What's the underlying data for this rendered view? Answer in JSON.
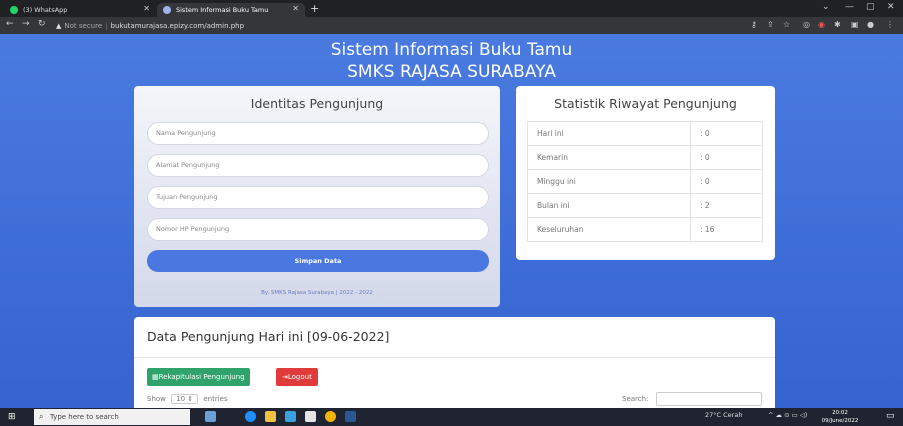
{
  "browser": {
    "tabs": [
      {
        "label": "(3) WhatsApp"
      },
      {
        "label": "Sistem Informasi Buku Tamu"
      }
    ],
    "new_tab_label": "+",
    "not_secure_label": "Not secure",
    "url": "bukutamurajasa.epizy.com/admin.php"
  },
  "header": {
    "title_line1": "Sistem Informasi Buku Tamu",
    "title_line2": "SMKS RAJASA SURABAYA"
  },
  "form": {
    "title": "Identitas Pengunjung",
    "fields": [
      {
        "placeholder": "Nama Pengunjung"
      },
      {
        "placeholder": "Alamat Pengunjung"
      },
      {
        "placeholder": "Tujuan Pengunjung"
      },
      {
        "placeholder": "Nomor HP Pengunjung"
      }
    ],
    "submit_label": "Simpan Data",
    "footer": "By. SMKS Rajasa Surabaya | 2022 - 2022"
  },
  "stats": {
    "title": "Statistik Riwayat Pengunjung",
    "rows": [
      {
        "label": "Hari ini",
        "value": ": 0"
      },
      {
        "label": "Kemarin",
        "value": ": 0"
      },
      {
        "label": "Minggu ini",
        "value": ": 0"
      },
      {
        "label": "Bulan ini",
        "value": ": 2"
      },
      {
        "label": "Keseluruhan",
        "value": ": 16"
      }
    ]
  },
  "data_section": {
    "title": "Data Pengunjung Hari ini [09-06-2022]",
    "rekap_label": "Rekapitulasi Pengunjung",
    "logout_label": "Logout",
    "show_label": "Show",
    "entries_value": "10",
    "entries_label": "entries",
    "search_label": "Search:"
  },
  "taskbar": {
    "search_placeholder": "Type here to search",
    "weather": "27°C Cerah",
    "time": "20:02",
    "date": "09/June/2022"
  },
  "colors": {
    "page_bg": "#3d6fd8",
    "primary_button": "#4a78e0",
    "rekap_button": "#2fa36b",
    "logout_button": "#e03b3b"
  }
}
